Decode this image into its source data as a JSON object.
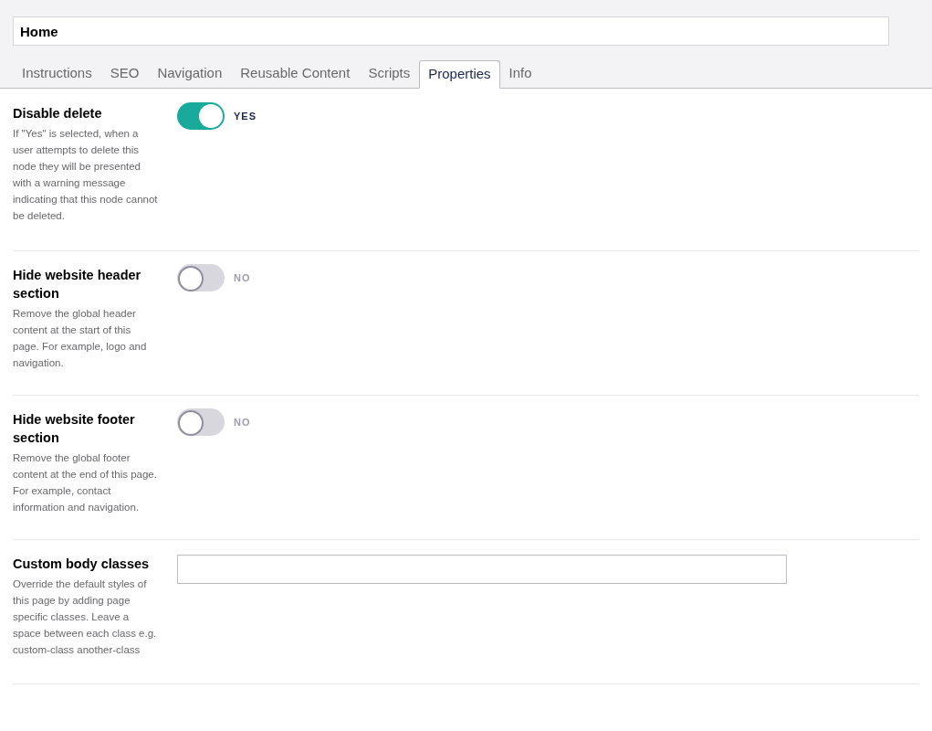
{
  "name_field": {
    "value": "Home"
  },
  "tabs": [
    {
      "label": "Instructions",
      "selected": false
    },
    {
      "label": "SEO",
      "selected": false
    },
    {
      "label": "Navigation",
      "selected": false
    },
    {
      "label": "Reusable Content",
      "selected": false
    },
    {
      "label": "Scripts",
      "selected": false
    },
    {
      "label": "Properties",
      "selected": true
    },
    {
      "label": "Info",
      "selected": false
    }
  ],
  "properties": [
    {
      "kind": "toggle",
      "label": "Disable delete",
      "description": "If \"Yes\" is selected, when a user attempts to delete this node they will be presented with a warning message indicating that this node cannot be deleted.",
      "on": true,
      "state_label": "YES"
    },
    {
      "kind": "toggle",
      "label": "Hide website header section",
      "description": "Remove the global header content at the start of this page. For example, logo and navigation.",
      "on": false,
      "state_label": "NO"
    },
    {
      "kind": "toggle",
      "label": "Hide website footer section",
      "description": "Remove the global footer content at the end of this page. For example, contact information and navigation.",
      "on": false,
      "state_label": "NO"
    },
    {
      "kind": "text",
      "label": "Custom body classes",
      "description": "Override the default styles of this page by adding page specific classes. Leave a space between each class e.g. custom-class another-class"
    }
  ]
}
